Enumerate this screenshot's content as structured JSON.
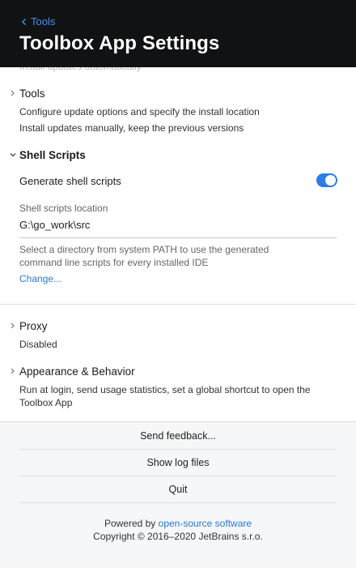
{
  "header": {
    "back_label": "Tools",
    "title": "Toolbox App Settings",
    "scrolled_text": "Install updates automatically"
  },
  "sections": {
    "tools": {
      "title": "Tools",
      "line1": "Configure update options and specify the install location",
      "line2": "Install updates manually, keep the previous versions"
    },
    "shell_scripts": {
      "title": "Shell Scripts",
      "generate_label": "Generate shell scripts",
      "generate_enabled": true,
      "location_label": "Shell scripts location",
      "location_value": "G:\\go_work\\src",
      "help_line1": "Select a directory from system PATH to use the generated",
      "help_line2": "command line scripts for every installed IDE",
      "change_link": "Change..."
    },
    "proxy": {
      "title": "Proxy",
      "status": "Disabled"
    },
    "appearance": {
      "title": "Appearance & Behavior",
      "line1": "Run at login, send usage statistics, set a global shortcut to open the",
      "line2": "Toolbox App"
    }
  },
  "footer": {
    "send_feedback": "Send feedback...",
    "show_logs": "Show log files",
    "quit": "Quit",
    "powered_prefix": "Powered by ",
    "powered_link": "open-source software",
    "copyright": "Copyright © 2016–2020 JetBrains s.r.o."
  },
  "colors": {
    "header_bg": "#111213",
    "accent": "#2c7ee6",
    "link": "#2a77d4"
  }
}
